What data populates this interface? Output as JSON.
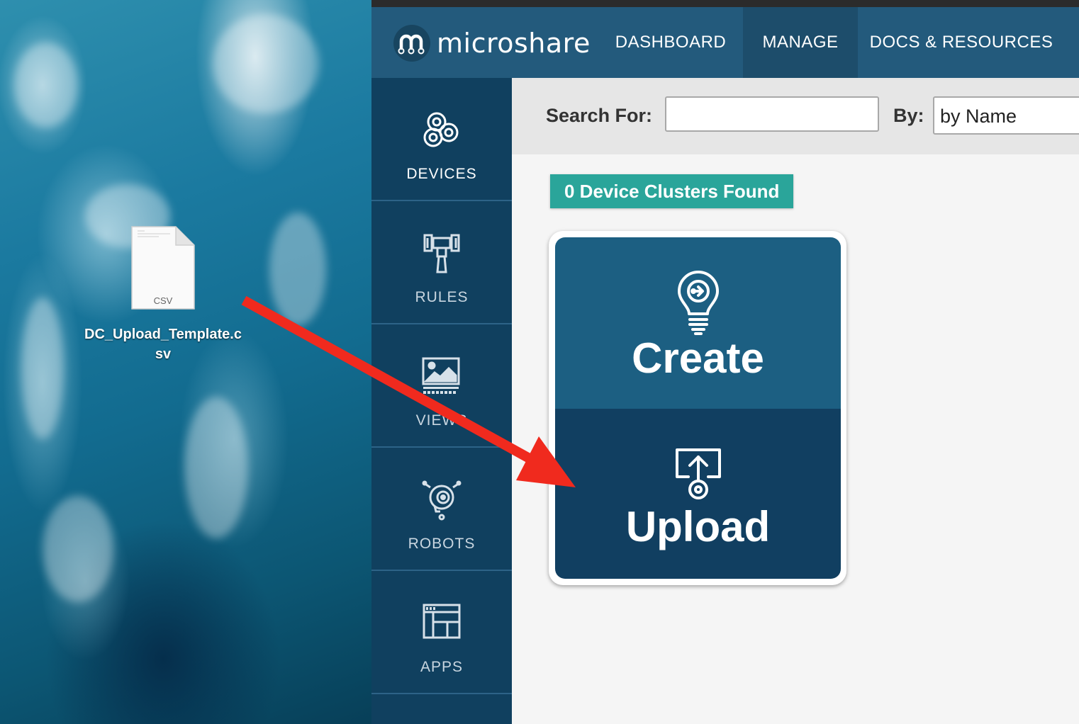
{
  "desktop": {
    "file": {
      "name": "DC_Upload_Template.csv",
      "type_label": "CSV",
      "icon": "csv-document-icon"
    }
  },
  "app": {
    "brand": "microshare",
    "nav": [
      {
        "label": "DASHBOARD",
        "active": false
      },
      {
        "label": "MANAGE",
        "active": true
      },
      {
        "label": "DOCS & RESOURCES",
        "active": false
      }
    ],
    "sidebar": [
      {
        "label": "DEVICES",
        "icon": "devices-icon",
        "active": true
      },
      {
        "label": "RULES",
        "icon": "rules-icon",
        "active": false
      },
      {
        "label": "VIEWS",
        "icon": "views-icon",
        "active": false
      },
      {
        "label": "ROBOTS",
        "icon": "robots-icon",
        "active": false
      },
      {
        "label": "APPS",
        "icon": "apps-icon",
        "active": false
      }
    ],
    "search": {
      "label": "Search For:",
      "value": "",
      "by_label": "By:",
      "by_value": "by Name"
    },
    "found_badge": "0 Device Clusters Found",
    "actions": {
      "create_label": "Create",
      "upload_label": "Upload"
    }
  },
  "annotation": {
    "arrow_color": "#f02a1e"
  }
}
